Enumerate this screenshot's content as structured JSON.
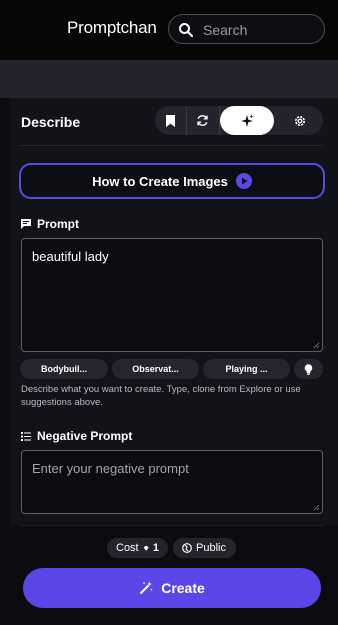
{
  "header": {
    "brand": "Promptchan",
    "search": {
      "placeholder": "Search",
      "icon": "search-icon"
    }
  },
  "describe": {
    "title": "Describe",
    "tools": [
      {
        "icon": "bookmark-icon"
      },
      {
        "icon": "refresh-icon"
      },
      {
        "icon": "sparkle-icon",
        "active": true
      },
      {
        "icon": "gear-icon"
      }
    ]
  },
  "how_to": {
    "label": "How to Create Images",
    "icon": "play-circle-icon"
  },
  "prompt": {
    "label": "Prompt",
    "value": "beautiful lady",
    "suggestions": [
      "Bodybuil...",
      "Observat...",
      "Playing ..."
    ],
    "hint": "Describe what you want to create. Type, clone from Explore or use suggestions above."
  },
  "negative_prompt": {
    "label": "Negative Prompt",
    "placeholder": "Enter your negative prompt"
  },
  "footer": {
    "cost_label": "Cost",
    "cost_value": "1",
    "visibility": "Public",
    "create_label": "Create"
  },
  "colors": {
    "accent": "#5b47e8",
    "panel": "#121219",
    "background": "#0c0c10"
  }
}
